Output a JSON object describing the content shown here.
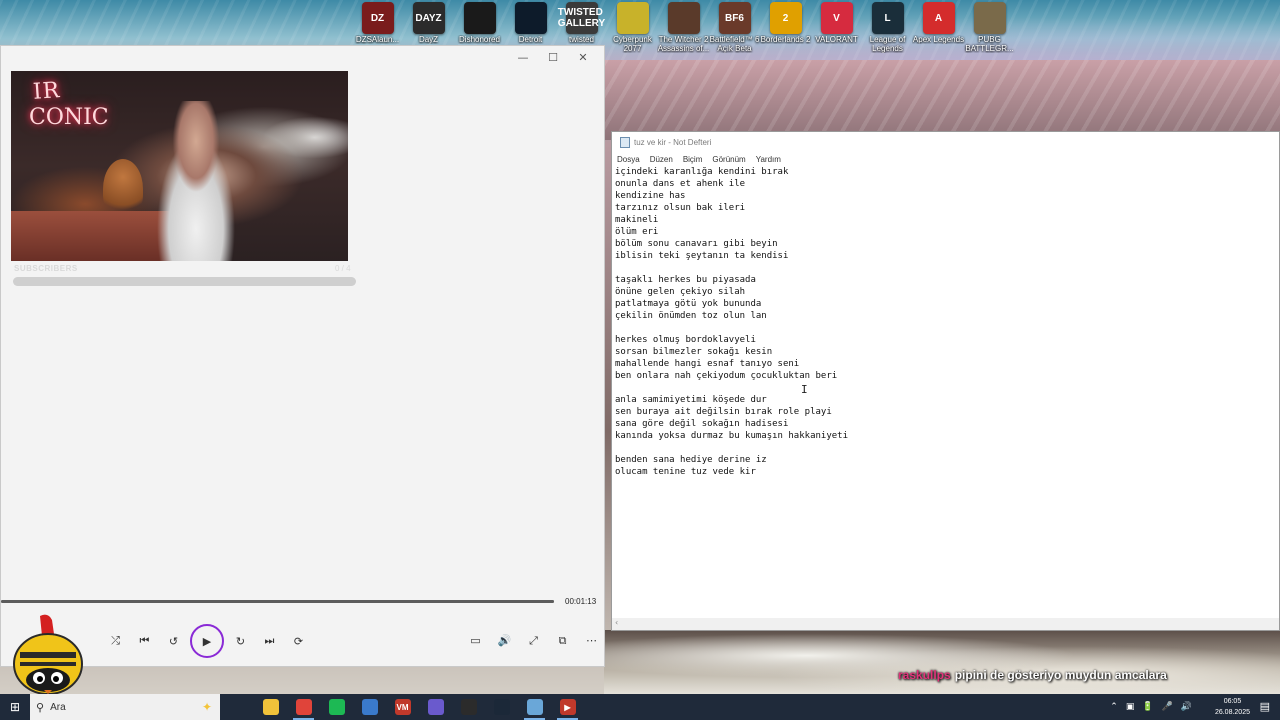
{
  "desktop_icons": [
    {
      "label": "DZSAlaun...",
      "icon": "dzsa-launcher-icon",
      "tile_text": "DZ",
      "color": "#7a1c1c"
    },
    {
      "label": "DayZ",
      "icon": "dayz-icon",
      "tile_text": "DAYZ",
      "color": "#2b2b2b"
    },
    {
      "label": "Dishonored",
      "icon": "dishonored-icon",
      "tile_text": "",
      "color": "#1a1a1a"
    },
    {
      "label": "Detroit",
      "icon": "detroit-icon",
      "tile_text": "",
      "color": "#0d1b2a"
    },
    {
      "label": "twisted",
      "icon": "twisted-gallery-icon",
      "tile_text": "TWISTED GALLERY",
      "color": "#3a3a3a"
    },
    {
      "label": "Cyberpunk 2077",
      "icon": "cyberpunk-icon",
      "tile_text": "",
      "color": "#c8b22a"
    },
    {
      "label": "The Witcher 2 Assassins of...",
      "icon": "witcher-icon",
      "tile_text": "",
      "color": "#5a3a2a"
    },
    {
      "label": "Battlefield™ 6 Açık Beta",
      "icon": "battlefield-icon",
      "tile_text": "BF6",
      "color": "#6a3a2a"
    },
    {
      "label": "Borderlands 2",
      "icon": "borderlands-icon",
      "tile_text": "2",
      "color": "#e0a000"
    },
    {
      "label": "VALORANT",
      "icon": "valorant-icon",
      "tile_text": "V",
      "color": "#d62b3f"
    },
    {
      "label": "League of Legends",
      "icon": "league-icon",
      "tile_text": "L",
      "color": "#1a2e3a"
    },
    {
      "label": "Apex Legends",
      "icon": "apex-icon",
      "tile_text": "A",
      "color": "#d42c2c"
    },
    {
      "label": "PUBG BATTLEGR...",
      "icon": "pubg-icon",
      "tile_text": "",
      "color": "#7a6a4a"
    }
  ],
  "player": {
    "window_controls": {
      "minimize": "—",
      "maximize": "☐",
      "close": "✕"
    },
    "video_neon_line1": "IR",
    "video_neon_line2": "CONIC",
    "subscriber_overlay": "SUBSCRIBERS",
    "subscriber_count": "0 / 4",
    "time": "00:01:13",
    "progress": 1.0,
    "controls": {
      "shuffle": "⤮",
      "previous": "⏮",
      "rewind": "↺",
      "play": "▶",
      "forward": "↻",
      "next": "⏭",
      "repeat": "⟳"
    },
    "controls_right": {
      "subtitles": "▭",
      "volume": "🔊",
      "fullscreen": "⤢",
      "miniplayer": "⧉",
      "more": "⋯"
    }
  },
  "notepad": {
    "title": "tuz ve kir - Not Defteri",
    "menu": [
      "Dosya",
      "Düzen",
      "Biçim",
      "Görünüm",
      "Yardım"
    ],
    "content": "içindeki karanlığa kendini bırak\nonunla dans et ahenk ile\nkendizine has\ntarzınız olsun bak ileri\nmakineli\nölüm eri\nbölüm sonu canavarı gibi beyin\niblisin teki şeytanın ta kendisi\n\ntaşaklı herkes bu piyasada\nönüne gelen çekiyo silah\npatlatmaya götü yok bununda\nçekilin önümden toz olun lan\n\nherkes olmuş bordoklavyeli\nsorsan bilmezler sokağı kesin\nmahallende hangi esnaf tanıyo seni\nben onlara nah çekiyodum çocukluktan beri\n\nanla samimiyetimi köşede dur\nsen buraya ait değilsin bırak role playi\nsana göre değil sokağın hadisesi\nkanında yoksa durmaz bu kumaşın hakkaniyeti\n\nbenden sana hediye derine iz\nolucam tenine tuz vede kir"
  },
  "chat": {
    "user": "raskullps",
    "message": "pipini de gösteriyo muydun amcalara"
  },
  "taskbar": {
    "search_placeholder": "Ara",
    "apps": [
      {
        "name": "file-explorer",
        "icon": "folder-icon",
        "glyph": "",
        "color": "#f0c23a",
        "active": false
      },
      {
        "name": "chrome",
        "icon": "chrome-icon",
        "glyph": "",
        "color": "#e0443a",
        "active": true
      },
      {
        "name": "spotify",
        "icon": "spotify-icon",
        "glyph": "",
        "color": "#1db954",
        "active": false
      },
      {
        "name": "app-blue",
        "icon": "diamond-app-icon",
        "glyph": "",
        "color": "#3a7acb",
        "active": false
      },
      {
        "name": "voicemeeter",
        "icon": "voicemeeter-icon",
        "glyph": "VM",
        "color": "#c0392b",
        "active": false
      },
      {
        "name": "discord",
        "icon": "discord-icon",
        "glyph": "",
        "color": "#6a5acd",
        "active": false
      },
      {
        "name": "obs",
        "icon": "obs-icon",
        "glyph": "",
        "color": "#2b2b2b",
        "active": false
      },
      {
        "name": "steam",
        "icon": "steam-icon",
        "glyph": "",
        "color": "#1b2838",
        "active": false
      },
      {
        "name": "notepad",
        "icon": "notepad-icon",
        "glyph": "",
        "color": "#6aa7d8",
        "active": true
      },
      {
        "name": "media-player",
        "icon": "media-player-icon",
        "glyph": "▶",
        "color": "#c0392b",
        "active": true
      }
    ],
    "tray": [
      "⌃",
      "▣",
      "🔋",
      "🎤",
      "🔊"
    ],
    "time": "06:05",
    "date": "26.08.2025"
  }
}
